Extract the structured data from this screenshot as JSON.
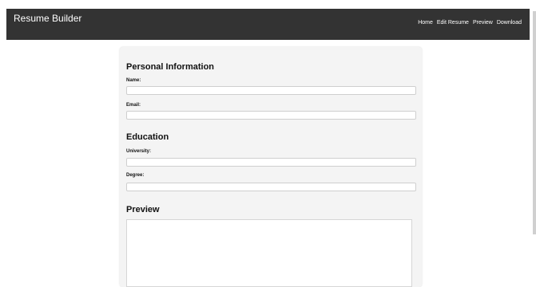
{
  "header": {
    "title": "Resume Builder",
    "nav": [
      "Home",
      "Edit Resume",
      "Preview",
      "Download"
    ]
  },
  "personal": {
    "title": "Personal Information",
    "name_label": "Name:",
    "email_label": "Email:"
  },
  "education": {
    "title": "Education",
    "university_label": "University:",
    "degree_label": "Degree:"
  },
  "preview": {
    "title": "Preview"
  },
  "colors": {
    "header_bg": "#333333",
    "page_bg": "#ffffff",
    "card_bg": "#f4f4f4"
  }
}
